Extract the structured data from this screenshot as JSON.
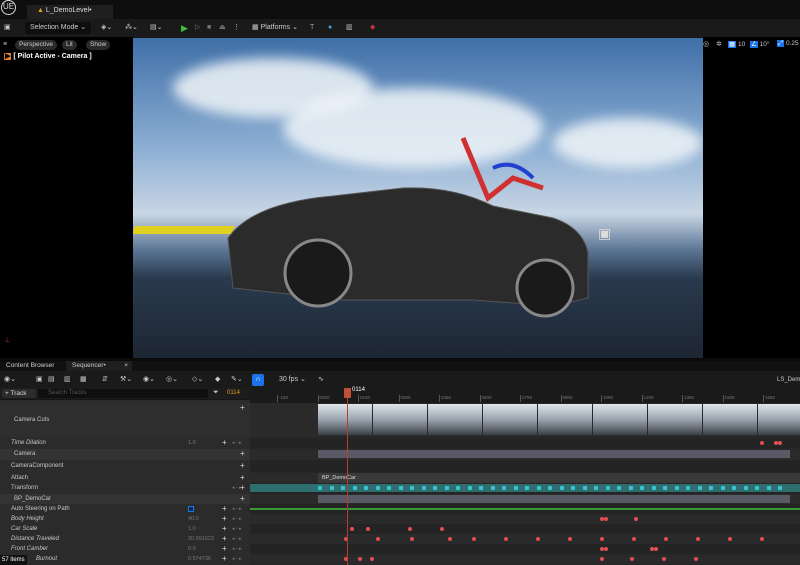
{
  "app": {
    "logo": "UE",
    "level_tab": "L_DemoLevel•"
  },
  "toolbar": {
    "selection_mode": "Selection Mode",
    "platforms": "Platforms",
    "icons": [
      "save-icon",
      "add-actor-icon",
      "blueprint-icon",
      "cinematics-icon",
      "play-icon",
      "step-icon",
      "stop-icon",
      "eject-icon",
      "more-icon",
      "modeling-icon",
      "world-icon",
      "snapshot-icon",
      "layers-icon"
    ]
  },
  "viewport": {
    "perspective": "Perspective",
    "lit": "Lit",
    "show": "Show",
    "pilot": "[ Pilot Active - Camera ]",
    "grid_snap": "10",
    "rot_snap": "10°",
    "scale_snap": "0.25"
  },
  "bottom_tabs": {
    "content_browser": "Content Browser",
    "sequencer": "Sequencer•"
  },
  "sequencer": {
    "fps": "30 fps",
    "sequence_name": "LS_DemoCar",
    "add_track": "+ Track",
    "search_placeholder": "Search Tracks",
    "current_frame": "0114",
    "playhead_label": "0114",
    "items_count": "57 items",
    "ruler_ticks": [
      "-150",
      "0000",
      "0150",
      "0300",
      "0450",
      "0600",
      "0750",
      "0900",
      "1050",
      "1200",
      "1350",
      "1500",
      "1650"
    ],
    "section_label": "BP_DemoCar",
    "tracks": [
      {
        "label": "Camera Cuts",
        "value": "",
        "indent": 0,
        "italic": false
      },
      {
        "label": "Time Dilation",
        "value": "1.0",
        "indent": 1,
        "italic": true
      },
      {
        "label": "Camera",
        "value": "",
        "indent": 0,
        "italic": false
      },
      {
        "label": "CameraComponent",
        "value": "",
        "indent": 1,
        "italic": false
      },
      {
        "label": "Attach",
        "value": "",
        "indent": 1,
        "italic": false
      },
      {
        "label": "Transform",
        "value": "",
        "indent": 1,
        "italic": false
      },
      {
        "label": "BP_DemoCar",
        "value": "",
        "indent": 0,
        "italic": false
      },
      {
        "label": "Auto Steering on Path",
        "value": "",
        "indent": 1,
        "italic": false
      },
      {
        "label": "Body Height",
        "value": "40.0",
        "indent": 1,
        "italic": true
      },
      {
        "label": "Car Scale",
        "value": "1.0",
        "indent": 1,
        "italic": true
      },
      {
        "label": "Distance Traveled",
        "value": "20.991623",
        "indent": 1,
        "italic": true
      },
      {
        "label": "Front Camber",
        "value": "0.0",
        "indent": 1,
        "italic": true
      },
      {
        "label": "Burnout",
        "value": "0.574736",
        "indent": 1,
        "italic": true
      }
    ],
    "auto_steering_checked": true
  },
  "colors": {
    "accent": "#1a73e8",
    "key": "#e05050",
    "section": "#2f6e6e",
    "playhead": "#c0503a"
  }
}
